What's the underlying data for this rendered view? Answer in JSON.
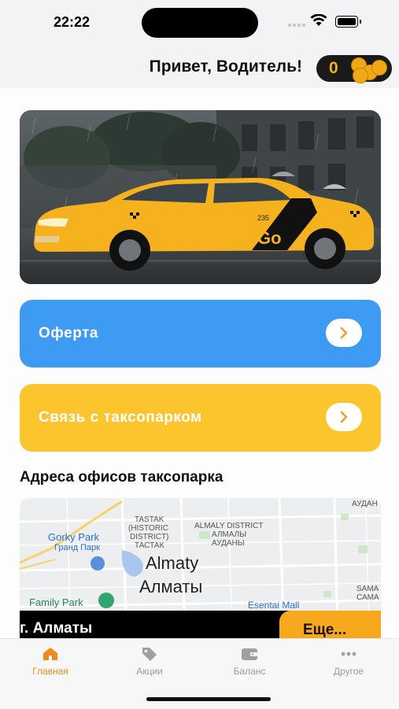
{
  "status_bar": {
    "time": "22:22"
  },
  "header": {
    "greeting": "Привет, Водитель!",
    "coins": "0"
  },
  "hero": {
    "image": "yellow-taxi-photo",
    "taxi_number": "235"
  },
  "cards": [
    {
      "label": "Оферта",
      "color": "#3d9bf3"
    },
    {
      "label": "Связь с таксопарком",
      "color": "#fcc42d"
    }
  ],
  "offices": {
    "title": "Адреса офисов таксопарка",
    "map": {
      "labels": {
        "gorky_park_en": "Gorky Park",
        "gorky_park_ru": "Гранд Парк",
        "tastak_1": "TASTAK",
        "tastak_2": "(HISTORIC",
        "tastak_3": "DISTRICT)",
        "tastak_4": "ТАСТАК",
        "almaly_1": "ALMALY DISTRICT",
        "almaly_2": "АЛМАЛЫ",
        "almaly_3": "АУДАНЫ",
        "city_en": "Almaty",
        "city_ru": "Алматы",
        "family_park": "Family Park",
        "esentai": "Esentai Mall",
        "audany": "АУДАН",
        "samal_1": "SAMA",
        "samal_2": "САМА"
      }
    },
    "city": "г. Алматы",
    "more_button": "Еще..."
  },
  "tabbar": {
    "items": [
      {
        "label": "Главная",
        "icon": "home-icon",
        "active": true
      },
      {
        "label": "Акции",
        "icon": "tag-icon",
        "active": false
      },
      {
        "label": "Баланс",
        "icon": "wallet-icon",
        "active": false
      },
      {
        "label": "Другое",
        "icon": "more-icon",
        "active": false
      }
    ]
  },
  "colors": {
    "accent": "#f08a1c",
    "blue_card": "#3d9bf3",
    "yellow_card": "#fcc42d",
    "more_button": "#f7a81c"
  }
}
